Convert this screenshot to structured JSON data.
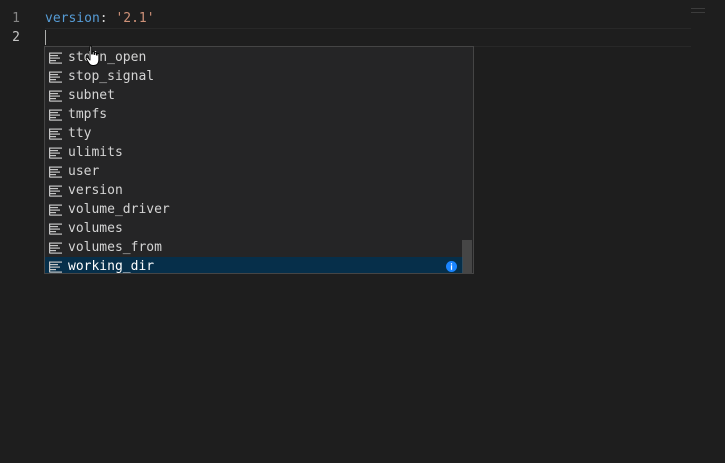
{
  "editor": {
    "lines": [
      {
        "number": "1",
        "key": "version",
        "colon": ": ",
        "value": "'2.1'"
      },
      {
        "number": "2",
        "key": "",
        "colon": "",
        "value": ""
      }
    ]
  },
  "suggest": {
    "items": [
      {
        "label": "stdin_open"
      },
      {
        "label": "stop_signal"
      },
      {
        "label": "subnet"
      },
      {
        "label": "tmpfs"
      },
      {
        "label": "tty"
      },
      {
        "label": "ulimits"
      },
      {
        "label": "user"
      },
      {
        "label": "version"
      },
      {
        "label": "volume_driver"
      },
      {
        "label": "volumes"
      },
      {
        "label": "volumes_from"
      },
      {
        "label": "working_dir"
      }
    ],
    "focused_label": "working_dir",
    "kind_icon": "property-icon",
    "info_icon": "info-icon"
  },
  "colors": {
    "background": "#1e1e1e",
    "widget_background": "#252526",
    "focus_background": "#062f4a",
    "key": "#569cd6",
    "string": "#ce9178",
    "info_accent": "#1a85ff"
  }
}
